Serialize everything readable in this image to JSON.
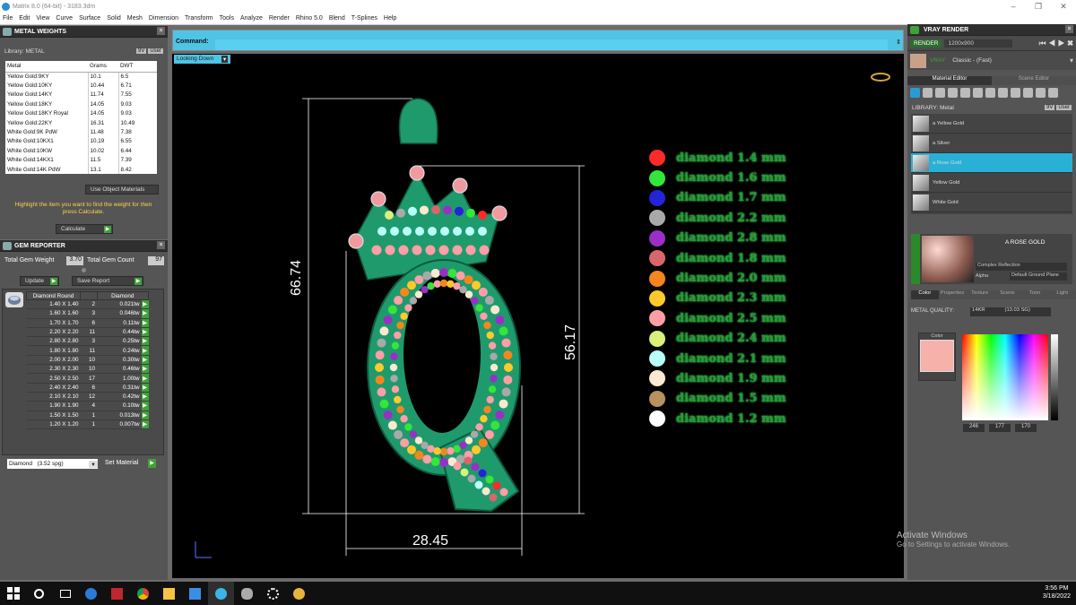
{
  "window": {
    "title": "Matrix 8.0 (64-bit) - 3183.3dm"
  },
  "menu": [
    "File",
    "Edit",
    "View",
    "Curve",
    "Surface",
    "Solid",
    "Mesh",
    "Dimension",
    "Transform",
    "Tools",
    "Analyze",
    "Render",
    "Rhino 5.0",
    "Blend",
    "T-Splines",
    "Help"
  ],
  "metal_weights": {
    "title": "METAL WEIGHTS",
    "library": "Library: METAL",
    "toggles": [
      "9V",
      "User"
    ],
    "columns": [
      "Metal",
      "Grams",
      "DWT"
    ],
    "rows": [
      [
        "Yellow Gold:9KY",
        "10.1",
        "6.5"
      ],
      [
        "Yellow Gold:10KY",
        "10.44",
        "6.71"
      ],
      [
        "Yellow Gold:14KY",
        "11.74",
        "7.55"
      ],
      [
        "Yellow Gold:18KY",
        "14.05",
        "9.03"
      ],
      [
        "Yellow Gold:18KY Royal",
        "14.05",
        "9.03"
      ],
      [
        "Yellow Gold:22KY",
        "16.31",
        "10.49"
      ],
      [
        "White Gold:9K PdW",
        "11.48",
        "7.38"
      ],
      [
        "White Gold:10KX1",
        "10.19",
        "6.55"
      ],
      [
        "White Gold:10KW",
        "10.02",
        "6.44"
      ],
      [
        "White Gold:14KX1",
        "11.5",
        "7.39"
      ],
      [
        "White Gold:14K PdW",
        "13.1",
        "8.42"
      ]
    ],
    "use_materials": "Use Object Materials",
    "hint": "Highlight the item you want to find the weight for then press Calculate.",
    "calculate": "Calculate"
  },
  "gem_reporter": {
    "title": "GEM REPORTER",
    "total_weight_label": "Total Gem Weight",
    "total_weight": "3.70",
    "total_count_label": "Total Gem Count",
    "total_count": "97",
    "update": "Update",
    "save_report": "Save Report",
    "columns": [
      "Diamond Round",
      "",
      "Diamond"
    ],
    "rows": [
      [
        "1.40 X 1.40",
        "2",
        "0.021tw"
      ],
      [
        "1.60 X 1.60",
        "3",
        "0.046tw"
      ],
      [
        "1.70 X 1.70",
        "6",
        "0.11tw"
      ],
      [
        "2.20 X 2.20",
        "11",
        "0.44tw"
      ],
      [
        "2.80 X 2.80",
        "3",
        "0.25tw"
      ],
      [
        "1.80 X 1.80",
        "11",
        "0.24tw"
      ],
      [
        "2.00 X 2.00",
        "10",
        "0.30tw"
      ],
      [
        "2.30 X 2.30",
        "10",
        "0.46tw"
      ],
      [
        "2.50 X 2.50",
        "17",
        "1.00tw"
      ],
      [
        "2.40 X 2.40",
        "6",
        "0.31tw"
      ],
      [
        "2.10 X 2.10",
        "12",
        "0.42tw"
      ],
      [
        "1.90 X 1.90",
        "4",
        "0.10tw"
      ],
      [
        "1.50 X 1.50",
        "1",
        "0.013tw"
      ],
      [
        "1.20 X 1.20",
        "1",
        "0.007tw"
      ]
    ],
    "material": "Diamond",
    "material_sg": "(3.52 spg)",
    "set_material": "Set Material"
  },
  "command": {
    "label": "Command:"
  },
  "viewport": {
    "view_label": "Looking Down",
    "dims": {
      "height_total": "66.74",
      "height_inner": "56.17",
      "width": "28.45"
    }
  },
  "legend": [
    {
      "label": "diamond 1.4 mm",
      "color": "#ff2a2a"
    },
    {
      "label": "diamond 1.6 mm",
      "color": "#33e63a"
    },
    {
      "label": "diamond 1.7 mm",
      "color": "#2323d8"
    },
    {
      "label": "diamond 2.2 mm",
      "color": "#a9a9a9"
    },
    {
      "label": "diamond 2.8 mm",
      "color": "#9a2fc8"
    },
    {
      "label": "diamond 1.8 mm",
      "color": "#d8666b"
    },
    {
      "label": "diamond 2.0 mm",
      "color": "#f5861e"
    },
    {
      "label": "diamond 2.3 mm",
      "color": "#ffc92b"
    },
    {
      "label": "diamond 2.5 mm",
      "color": "#ff9ea6"
    },
    {
      "label": "diamond 2.4 mm",
      "color": "#d9f07a"
    },
    {
      "label": "diamond 2.1 mm",
      "color": "#b8fff8"
    },
    {
      "label": "diamond 1.9 mm",
      "color": "#fbe8d0"
    },
    {
      "label": "diamond 1.5 mm",
      "color": "#b8915e"
    },
    {
      "label": "diamond 1.2 mm",
      "color": "#ffffff"
    }
  ],
  "vray": {
    "title": "VRAY RENDER",
    "render": "RENDER",
    "resolution": "1200x900",
    "preset_name": "Classic - (Fast)",
    "tabs": [
      "Material Editor",
      "Scene Editor"
    ],
    "library": "LIBRARY: Metal",
    "toggles": [
      "9V",
      "User"
    ],
    "materials": [
      "a Yellow Gold",
      "a Silver",
      "a Rose Gold",
      "Yellow Gold",
      "White Gold"
    ],
    "selected_name": "A ROSE GOLD",
    "reflection": "Complex Reflection",
    "alpha": "Alpha",
    "ground": "Default Ground Plane",
    "subtabs": [
      "Color",
      "Properties",
      "Texture",
      "Scene",
      "Toon",
      "Light"
    ],
    "metal_quality_label": "METAL QUALITY:",
    "metal_quality": "14KR",
    "metal_quality_sg": "(13.03 SG)",
    "color_label": "Color",
    "rgb": [
      "246",
      "177",
      "170"
    ],
    "swatch": "#f6b1aa"
  },
  "watermark": {
    "title": "Activate Windows",
    "sub": "Go to Settings to activate Windows."
  },
  "taskbar": {
    "time": "3:56 PM",
    "date": "3/18/2022"
  }
}
